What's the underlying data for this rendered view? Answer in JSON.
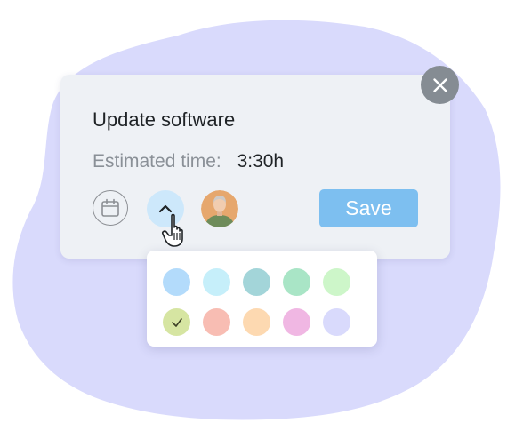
{
  "task": {
    "title": "Update software",
    "estimated_label": "Estimated time:",
    "estimated_value": "3:30h"
  },
  "actions": {
    "save_label": "Save"
  },
  "icons": {
    "close": "close-icon",
    "calendar": "calendar-icon",
    "chevron": "chevron-up-icon",
    "avatar": "user-avatar",
    "cursor": "hand-pointer-icon",
    "check": "checkmark-icon"
  },
  "colors": {
    "background_blob": "#d9dafc",
    "card_bg": "#eef1f5",
    "accent_save": "#7dbff0",
    "chevron_bg": "#cde8fb",
    "close_bg": "#858c93"
  },
  "palette": {
    "selected_index": 5,
    "swatches": [
      "#b3dbfb",
      "#c6effa",
      "#a3d5d9",
      "#a9e5c6",
      "#cdf6c9",
      "#d6e5a2",
      "#f8bdb3",
      "#fdd9b1",
      "#f0b7e3",
      "#d9dafc"
    ]
  }
}
